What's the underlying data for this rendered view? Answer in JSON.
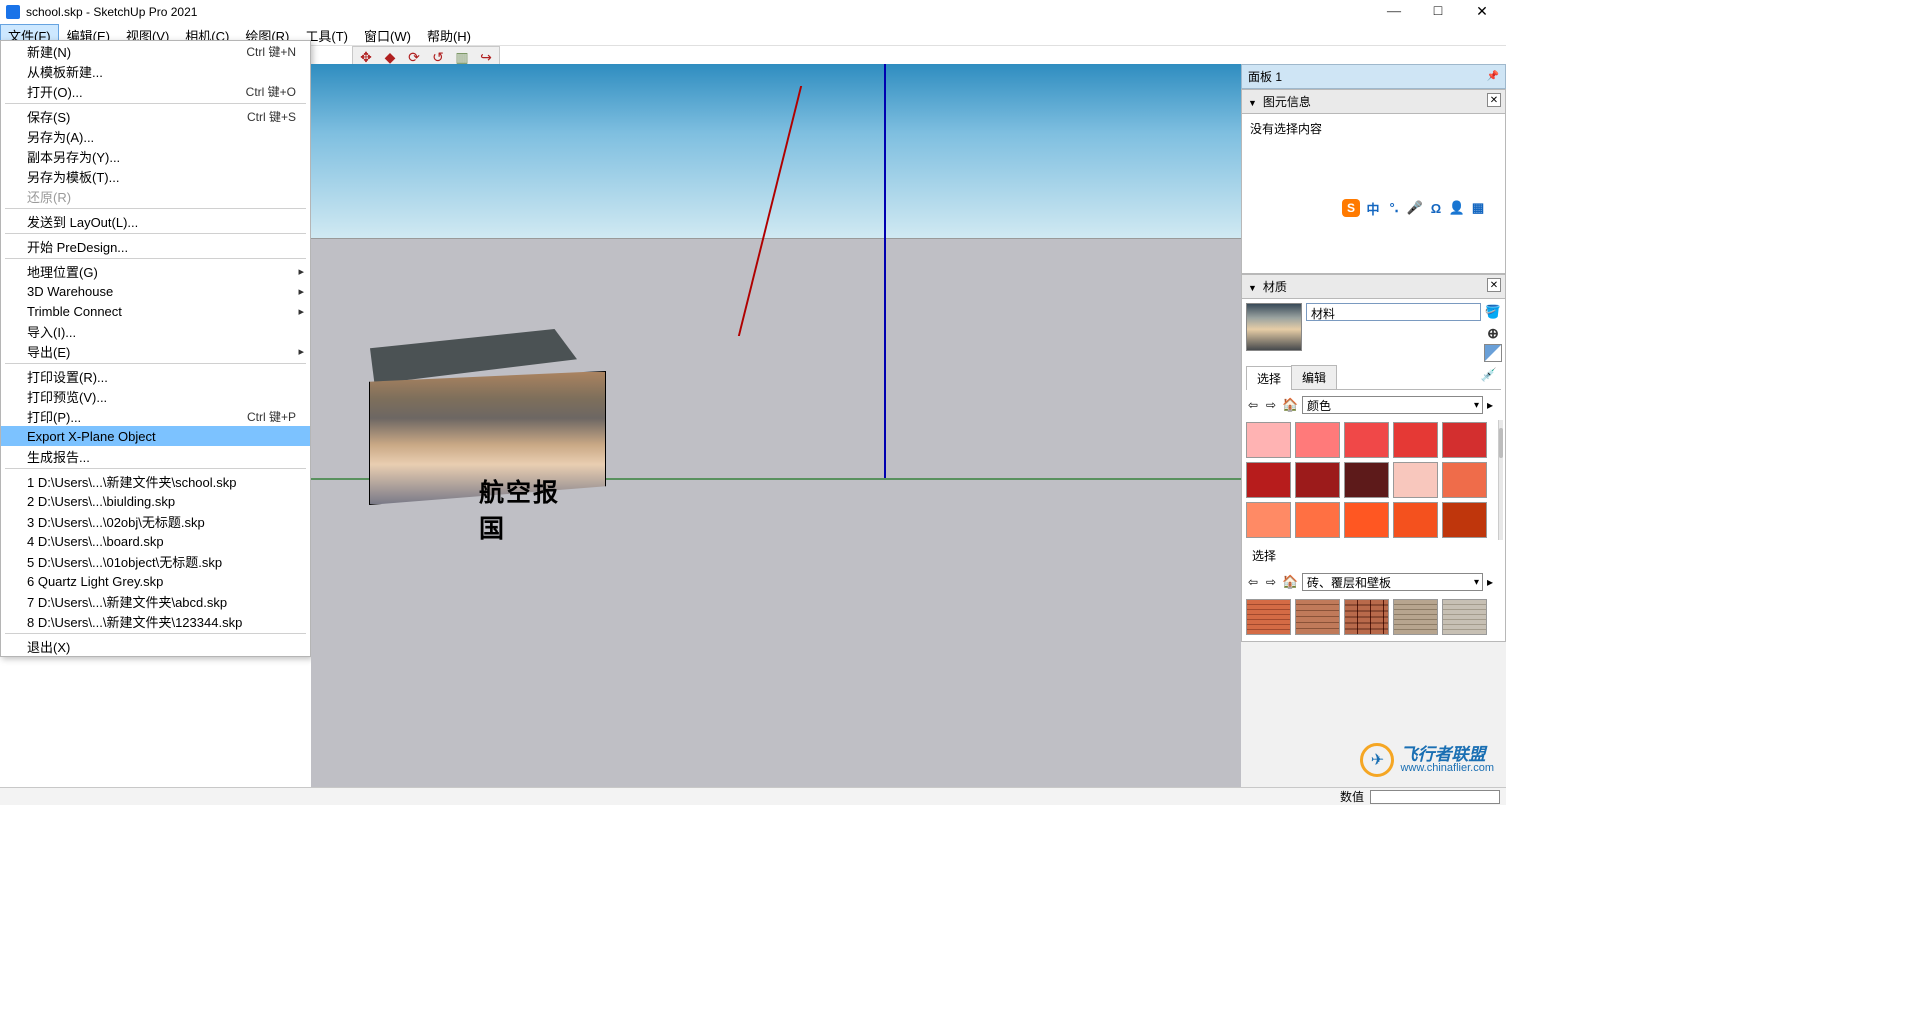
{
  "window": {
    "title": "school.skp - SketchUp Pro 2021"
  },
  "menubar": [
    {
      "label": "文件(F)",
      "open": true
    },
    {
      "label": "编辑(E)"
    },
    {
      "label": "视图(V)"
    },
    {
      "label": "相机(C)"
    },
    {
      "label": "绘图(R)"
    },
    {
      "label": "工具(T)"
    },
    {
      "label": "窗口(W)"
    },
    {
      "label": "帮助(H)"
    }
  ],
  "file_menu": [
    {
      "label": "新建(N)",
      "shortcut": "Ctrl 键+N"
    },
    {
      "label": "从模板新建..."
    },
    {
      "label": "打开(O)...",
      "shortcut": "Ctrl 键+O"
    },
    {
      "sep": true
    },
    {
      "label": "保存(S)",
      "shortcut": "Ctrl 键+S"
    },
    {
      "label": "另存为(A)..."
    },
    {
      "label": "副本另存为(Y)..."
    },
    {
      "label": "另存为模板(T)..."
    },
    {
      "label": "还原(R)",
      "disabled": true
    },
    {
      "sep": true
    },
    {
      "label": "发送到 LayOut(L)..."
    },
    {
      "sep": true
    },
    {
      "label": "开始 PreDesign..."
    },
    {
      "sep": true
    },
    {
      "label": "地理位置(G)",
      "submenu": true
    },
    {
      "label": "3D Warehouse",
      "submenu": true
    },
    {
      "label": "Trimble Connect",
      "submenu": true
    },
    {
      "label": "导入(I)..."
    },
    {
      "label": "导出(E)",
      "submenu": true
    },
    {
      "sep": true
    },
    {
      "label": "打印设置(R)..."
    },
    {
      "label": "打印预览(V)..."
    },
    {
      "label": "打印(P)...",
      "shortcut": "Ctrl 键+P"
    },
    {
      "label": "Export X-Plane Object",
      "highlight": true
    },
    {
      "label": "生成报告..."
    },
    {
      "sep": true
    },
    {
      "label": "1 D:\\Users\\...\\新建文件夹\\school.skp"
    },
    {
      "label": "2 D:\\Users\\...\\biulding.skp"
    },
    {
      "label": "3 D:\\Users\\...\\02obj\\无标题.skp"
    },
    {
      "label": "4 D:\\Users\\...\\board.skp"
    },
    {
      "label": "5 D:\\Users\\...\\01object\\无标题.skp"
    },
    {
      "label": "6 Quartz Light Grey.skp"
    },
    {
      "label": "7 D:\\Users\\...\\新建文件夹\\abcd.skp"
    },
    {
      "label": "8 D:\\Users\\...\\新建文件夹\\123344.skp"
    },
    {
      "sep": true
    },
    {
      "label": "退出(X)"
    }
  ],
  "toolbar_icons": [
    "move",
    "push",
    "rotate",
    "orbit",
    "pan",
    "redo"
  ],
  "viewport": {
    "cube_label": "航空报国"
  },
  "panels": {
    "tray_title": "面板 1",
    "entity_info": {
      "title": "图元信息",
      "message": "没有选择内容"
    },
    "ime": {
      "label": "中"
    },
    "materials": {
      "title": "材质",
      "name": "材料",
      "tabs": [
        "选择",
        "编辑"
      ],
      "category": "颜色",
      "select_label": "选择",
      "category2": "砖、覆层和壁板",
      "colors": [
        "#ffb3b3",
        "#ff7a7a",
        "#f04848",
        "#e53935",
        "#d32f2f",
        "#b71c1c",
        "#9c1b1b",
        "#5d1a1a",
        "#f8c7bd",
        "#ef6c4a",
        "#ff8a65",
        "#ff7043",
        "#ff5722",
        "#f4511e",
        "#bf360c"
      ]
    }
  },
  "watermark": {
    "cn": "飞行者联盟",
    "en": "www.chinaflier.com"
  },
  "statusbar": {
    "value_label": "数值"
  }
}
